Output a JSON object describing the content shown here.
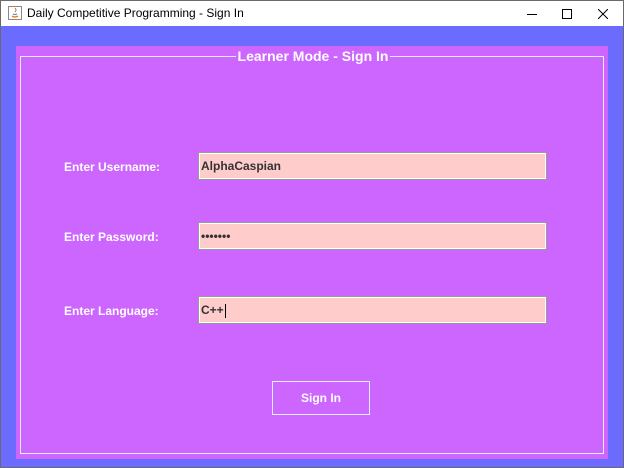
{
  "window": {
    "title": "Daily Competitive Programming - Sign In",
    "app_icon": "java-icon",
    "controls": [
      "minimize-icon",
      "maximize-icon",
      "close-icon"
    ]
  },
  "panel": {
    "title": "Learner Mode - Sign In"
  },
  "form": {
    "username_label": "Enter Username:",
    "username_value": "AlphaCaspian",
    "password_label": "Enter Password:",
    "password_value": "•••••••",
    "language_label": "Enter Language:",
    "language_value": "C++",
    "submit_label": "Sign In"
  },
  "colors": {
    "window_background": "#6b6bff",
    "panel_background": "#cc66ff",
    "field_background": "#ffcccc",
    "label_text": "#ffffff"
  }
}
